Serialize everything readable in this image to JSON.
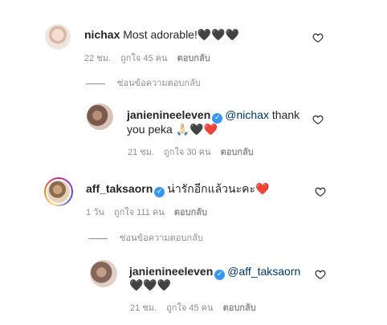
{
  "comments": [
    {
      "username": "nichax",
      "text": "Most adorable!",
      "emoji": "🖤🖤🖤",
      "time": "22 ชม.",
      "likes": "ถูกใจ 45 คน",
      "reply": "ตอบกลับ",
      "hide_replies": "ซ่อนข้อความตอบกลับ",
      "replies": [
        {
          "username": "janienineeleven",
          "mention": "@nichax",
          "text_line1": "thank",
          "text_line2": "you peka",
          "emoji": "🙏🏻🖤❤️",
          "time": "21 ชม.",
          "likes": "ถูกใจ 30 คน",
          "reply": "ตอบกลับ"
        }
      ]
    },
    {
      "username": "aff_taksaorn",
      "text": "น่ารักอีกแล้วนะคะ",
      "emoji": "❤️",
      "time": "1 วัน",
      "likes": "ถูกใจ 111 คน",
      "reply": "ตอบกลับ",
      "hide_replies": "ซ่อนข้อความตอบกลับ",
      "replies": [
        {
          "username": "janienineeleven",
          "mention": "@aff_taksaorn",
          "emoji": "🖤🖤🖤",
          "time": "21 ชม.",
          "likes": "ถูกใจ 45 คน",
          "reply": "ตอบกลับ"
        }
      ]
    }
  ],
  "icons": {
    "like": "heart-outline-icon",
    "verified": "verified-badge-icon"
  },
  "colors": {
    "text": "#262626",
    "meta": "#8e8e8e",
    "mention": "#00376b",
    "verified": "#3897f0"
  }
}
